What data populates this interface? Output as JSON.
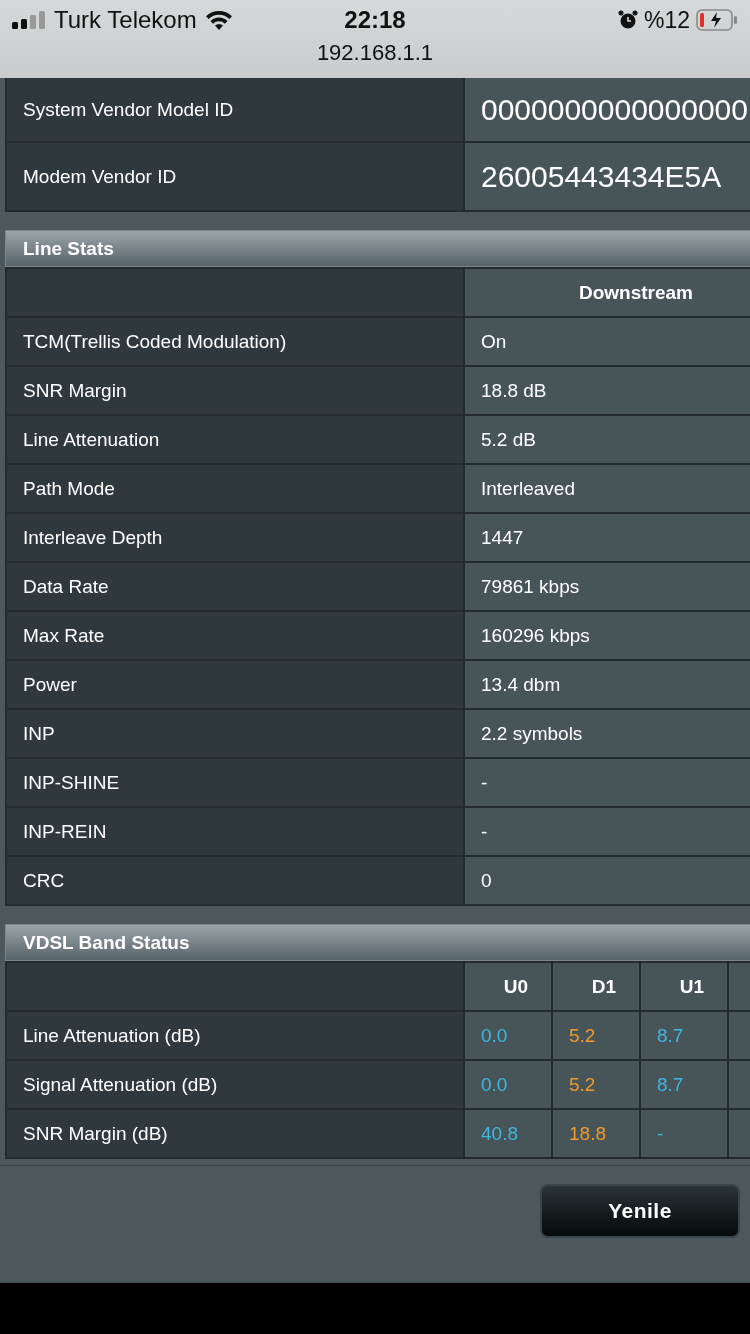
{
  "status_bar": {
    "carrier": "Turk Telekom",
    "time": "22:18",
    "battery": "%12",
    "url": "192.168.1.1"
  },
  "vendor_rows": [
    {
      "label": "System Vendor Model ID",
      "value": "0000000000000000"
    },
    {
      "label": "Modem Vendor ID",
      "value": "26005443434E5A"
    }
  ],
  "line_stats": {
    "title": "Line Stats",
    "columns": [
      "Downstream"
    ],
    "rows": [
      {
        "label": "TCM(Trellis Coded Modulation)",
        "values": [
          "On"
        ]
      },
      {
        "label": "SNR Margin",
        "values": [
          "18.8 dB"
        ]
      },
      {
        "label": "Line Attenuation",
        "values": [
          "5.2 dB"
        ]
      },
      {
        "label": "Path Mode",
        "values": [
          "Interleaved"
        ]
      },
      {
        "label": "Interleave Depth",
        "values": [
          "1447"
        ]
      },
      {
        "label": "Data Rate",
        "values": [
          "79861 kbps"
        ]
      },
      {
        "label": "Max Rate",
        "values": [
          "160296 kbps"
        ]
      },
      {
        "label": "Power",
        "values": [
          "13.4 dbm"
        ]
      },
      {
        "label": "INP",
        "values": [
          "2.2 symbols"
        ]
      },
      {
        "label": "INP-SHINE",
        "values": [
          "-"
        ]
      },
      {
        "label": "INP-REIN",
        "values": [
          "-"
        ]
      },
      {
        "label": "CRC",
        "values": [
          "0"
        ]
      }
    ]
  },
  "vdsl_band_status": {
    "title": "VDSL Band Status",
    "columns": [
      "U0",
      "D1",
      "U1"
    ],
    "rows": [
      {
        "label": "Line Attenuation (dB)",
        "cells": [
          {
            "value": "0.0",
            "color": "#3db7e4"
          },
          {
            "value": "5.2",
            "color": "#ef9a2a"
          },
          {
            "value": "8.7",
            "color": "#3db7e4"
          }
        ]
      },
      {
        "label": "Signal Attenuation (dB)",
        "cells": [
          {
            "value": "0.0",
            "color": "#3db7e4"
          },
          {
            "value": "5.2",
            "color": "#ef9a2a"
          },
          {
            "value": "8.7",
            "color": "#3db7e4"
          }
        ]
      },
      {
        "label": "SNR Margin (dB)",
        "cells": [
          {
            "value": "40.8",
            "color": "#3db7e4"
          },
          {
            "value": "18.8",
            "color": "#ef9a2a"
          },
          {
            "value": "-",
            "color": "#3db7e4"
          }
        ]
      }
    ]
  },
  "refresh_button": "Yenile"
}
